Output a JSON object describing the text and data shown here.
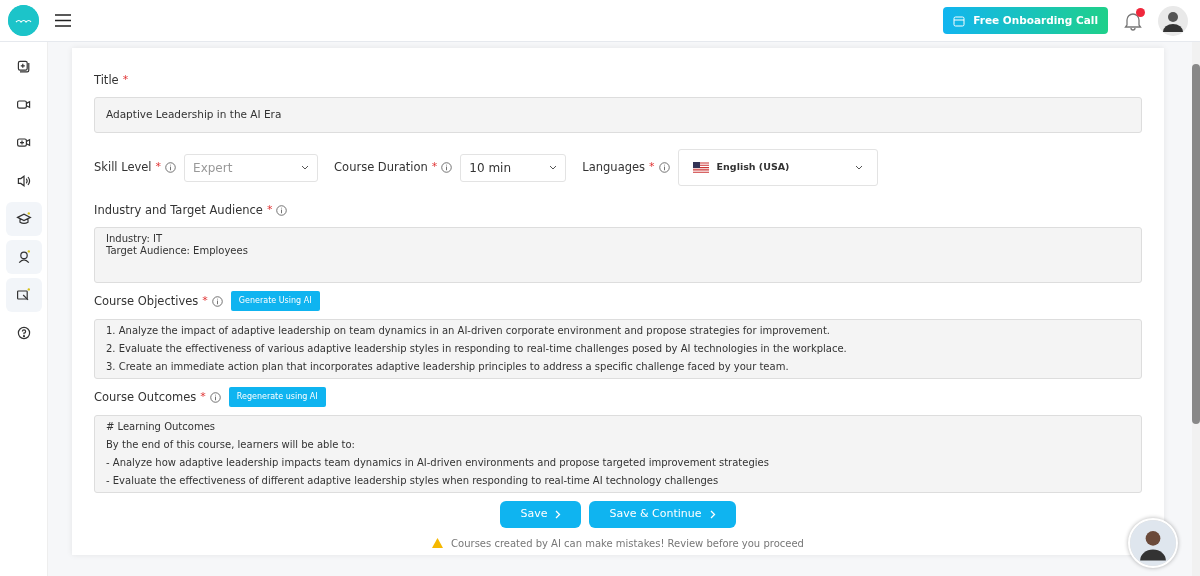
{
  "header": {
    "cta_button": "Free Onboarding Call",
    "notifications": {
      "unread": true
    }
  },
  "sidebar": {
    "items": [
      {
        "highlighted": false
      },
      {
        "highlighted": false
      },
      {
        "highlighted": false
      },
      {
        "highlighted": false
      },
      {
        "highlighted": true
      },
      {
        "highlighted": true
      },
      {
        "highlighted": true
      },
      {
        "highlighted": false
      }
    ]
  },
  "form": {
    "title": {
      "label": "Title",
      "required_mark": "*",
      "value": "Adaptive Leadership in the AI Era"
    },
    "selects": [
      {
        "label": "Skill Level",
        "required_mark": "*",
        "value": "Expert",
        "disabled": true,
        "kind": "plain"
      },
      {
        "label": "Course Duration",
        "required_mark": "*",
        "value": "10 min",
        "disabled": false,
        "kind": "plain"
      },
      {
        "label": "Languages",
        "required_mark": "*",
        "value": "English (USA)",
        "disabled": false,
        "kind": "flag"
      }
    ],
    "audience": {
      "label": "Industry and Target Audience",
      "required_mark": "*",
      "lines": [
        "Industry: IT",
        "Target Audience: Employees"
      ]
    },
    "objectives": {
      "label": "Course Objectives",
      "required_mark": "*",
      "ai_button": "Generate Using AI",
      "lines": [
        "1. Analyze the impact of adaptive leadership on team dynamics in an AI-driven corporate environment and propose strategies for improvement.",
        "2. Evaluate the effectiveness of various adaptive leadership styles in responding to real-time challenges posed by AI technologies in the workplace.",
        "3. Create an immediate action plan that incorporates adaptive leadership principles to address a specific challenge faced by your team."
      ]
    },
    "outcomes": {
      "label": "Course Outcomes",
      "required_mark": "*",
      "ai_button": "Regenerate using AI",
      "lines": [
        "# Learning Outcomes",
        "By the end of this course, learners will be able to:",
        "- Analyze how adaptive leadership impacts team dynamics in AI-driven environments and propose targeted improvement strategies",
        "- Evaluate the effectiveness of different adaptive leadership styles when responding to real-time AI technology challenges"
      ]
    },
    "actions": [
      "Save",
      "Save & Continue"
    ],
    "warning": "Courses created by AI can make mistakes! Review before you proceed"
  }
}
